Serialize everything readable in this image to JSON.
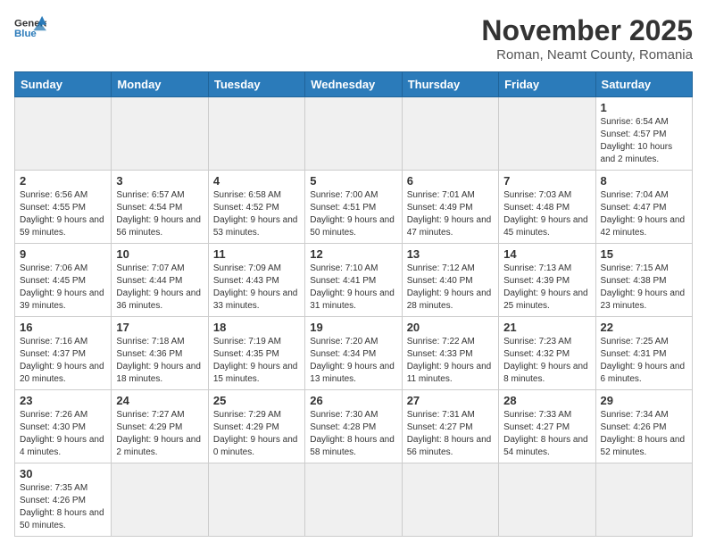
{
  "header": {
    "logo_general": "General",
    "logo_blue": "Blue",
    "month_title": "November 2025",
    "location": "Roman, Neamt County, Romania"
  },
  "weekdays": [
    "Sunday",
    "Monday",
    "Tuesday",
    "Wednesday",
    "Thursday",
    "Friday",
    "Saturday"
  ],
  "weeks": [
    [
      {
        "day": "",
        "info": ""
      },
      {
        "day": "",
        "info": ""
      },
      {
        "day": "",
        "info": ""
      },
      {
        "day": "",
        "info": ""
      },
      {
        "day": "",
        "info": ""
      },
      {
        "day": "",
        "info": ""
      },
      {
        "day": "1",
        "info": "Sunrise: 6:54 AM\nSunset: 4:57 PM\nDaylight: 10 hours and 2 minutes."
      }
    ],
    [
      {
        "day": "2",
        "info": "Sunrise: 6:56 AM\nSunset: 4:55 PM\nDaylight: 9 hours and 59 minutes."
      },
      {
        "day": "3",
        "info": "Sunrise: 6:57 AM\nSunset: 4:54 PM\nDaylight: 9 hours and 56 minutes."
      },
      {
        "day": "4",
        "info": "Sunrise: 6:58 AM\nSunset: 4:52 PM\nDaylight: 9 hours and 53 minutes."
      },
      {
        "day": "5",
        "info": "Sunrise: 7:00 AM\nSunset: 4:51 PM\nDaylight: 9 hours and 50 minutes."
      },
      {
        "day": "6",
        "info": "Sunrise: 7:01 AM\nSunset: 4:49 PM\nDaylight: 9 hours and 47 minutes."
      },
      {
        "day": "7",
        "info": "Sunrise: 7:03 AM\nSunset: 4:48 PM\nDaylight: 9 hours and 45 minutes."
      },
      {
        "day": "8",
        "info": "Sunrise: 7:04 AM\nSunset: 4:47 PM\nDaylight: 9 hours and 42 minutes."
      }
    ],
    [
      {
        "day": "9",
        "info": "Sunrise: 7:06 AM\nSunset: 4:45 PM\nDaylight: 9 hours and 39 minutes."
      },
      {
        "day": "10",
        "info": "Sunrise: 7:07 AM\nSunset: 4:44 PM\nDaylight: 9 hours and 36 minutes."
      },
      {
        "day": "11",
        "info": "Sunrise: 7:09 AM\nSunset: 4:43 PM\nDaylight: 9 hours and 33 minutes."
      },
      {
        "day": "12",
        "info": "Sunrise: 7:10 AM\nSunset: 4:41 PM\nDaylight: 9 hours and 31 minutes."
      },
      {
        "day": "13",
        "info": "Sunrise: 7:12 AM\nSunset: 4:40 PM\nDaylight: 9 hours and 28 minutes."
      },
      {
        "day": "14",
        "info": "Sunrise: 7:13 AM\nSunset: 4:39 PM\nDaylight: 9 hours and 25 minutes."
      },
      {
        "day": "15",
        "info": "Sunrise: 7:15 AM\nSunset: 4:38 PM\nDaylight: 9 hours and 23 minutes."
      }
    ],
    [
      {
        "day": "16",
        "info": "Sunrise: 7:16 AM\nSunset: 4:37 PM\nDaylight: 9 hours and 20 minutes."
      },
      {
        "day": "17",
        "info": "Sunrise: 7:18 AM\nSunset: 4:36 PM\nDaylight: 9 hours and 18 minutes."
      },
      {
        "day": "18",
        "info": "Sunrise: 7:19 AM\nSunset: 4:35 PM\nDaylight: 9 hours and 15 minutes."
      },
      {
        "day": "19",
        "info": "Sunrise: 7:20 AM\nSunset: 4:34 PM\nDaylight: 9 hours and 13 minutes."
      },
      {
        "day": "20",
        "info": "Sunrise: 7:22 AM\nSunset: 4:33 PM\nDaylight: 9 hours and 11 minutes."
      },
      {
        "day": "21",
        "info": "Sunrise: 7:23 AM\nSunset: 4:32 PM\nDaylight: 9 hours and 8 minutes."
      },
      {
        "day": "22",
        "info": "Sunrise: 7:25 AM\nSunset: 4:31 PM\nDaylight: 9 hours and 6 minutes."
      }
    ],
    [
      {
        "day": "23",
        "info": "Sunrise: 7:26 AM\nSunset: 4:30 PM\nDaylight: 9 hours and 4 minutes."
      },
      {
        "day": "24",
        "info": "Sunrise: 7:27 AM\nSunset: 4:29 PM\nDaylight: 9 hours and 2 minutes."
      },
      {
        "day": "25",
        "info": "Sunrise: 7:29 AM\nSunset: 4:29 PM\nDaylight: 9 hours and 0 minutes."
      },
      {
        "day": "26",
        "info": "Sunrise: 7:30 AM\nSunset: 4:28 PM\nDaylight: 8 hours and 58 minutes."
      },
      {
        "day": "27",
        "info": "Sunrise: 7:31 AM\nSunset: 4:27 PM\nDaylight: 8 hours and 56 minutes."
      },
      {
        "day": "28",
        "info": "Sunrise: 7:33 AM\nSunset: 4:27 PM\nDaylight: 8 hours and 54 minutes."
      },
      {
        "day": "29",
        "info": "Sunrise: 7:34 AM\nSunset: 4:26 PM\nDaylight: 8 hours and 52 minutes."
      }
    ],
    [
      {
        "day": "30",
        "info": "Sunrise: 7:35 AM\nSunset: 4:26 PM\nDaylight: 8 hours and 50 minutes."
      },
      {
        "day": "",
        "info": ""
      },
      {
        "day": "",
        "info": ""
      },
      {
        "day": "",
        "info": ""
      },
      {
        "day": "",
        "info": ""
      },
      {
        "day": "",
        "info": ""
      },
      {
        "day": "",
        "info": ""
      }
    ]
  ]
}
